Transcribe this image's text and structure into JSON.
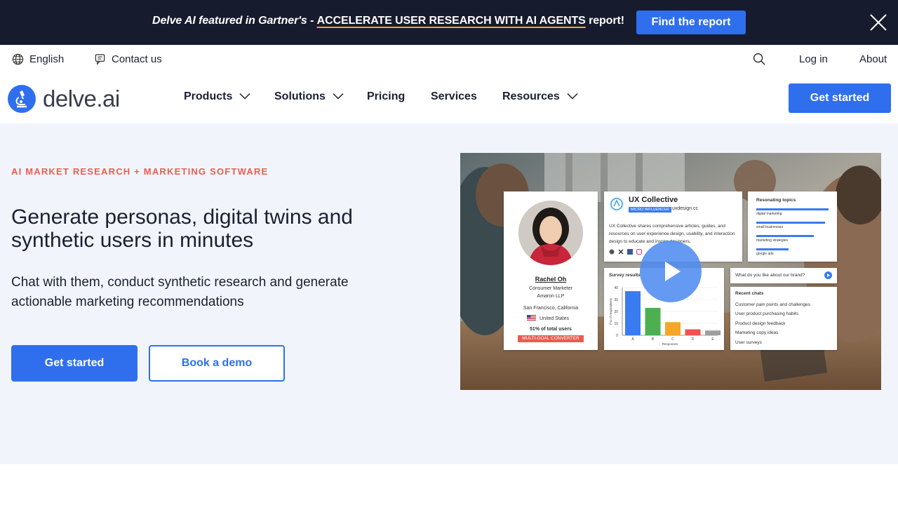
{
  "announcement": {
    "lead": "Delve AI featured in Gartner's - ",
    "link": "ACCELERATE USER RESEARCH WITH AI AGENTS",
    "tail": " report!",
    "button": "Find the report"
  },
  "utility": {
    "language": "English",
    "contact": "Contact us",
    "login": "Log in",
    "about": "About"
  },
  "nav": {
    "logo": "delve.ai",
    "items": [
      "Products",
      "Solutions",
      "Pricing",
      "Services",
      "Resources"
    ],
    "cta": "Get started"
  },
  "hero": {
    "eyebrow": "AI MARKET RESEARCH + MARKETING SOFTWARE",
    "headline": "Generate personas, digital twins and synthetic users in minutes",
    "subline": "Chat with them, conduct synthetic research and generate actionable marketing recommendations",
    "primary_button": "Get started",
    "secondary_button": "Book a demo"
  },
  "video": {
    "persona": {
      "name": "Rachel Oh",
      "role": "Consumer Marketer",
      "company": "Amaron LLP",
      "location": "San Francisco, California",
      "country": "United States",
      "share": "51% of total users",
      "tag": "MULTI-GOAL CONVERTER"
    },
    "brand": {
      "name": "UX Collective",
      "badge": "MICRO INFLUENCER",
      "domain": "uxdesign.cc",
      "desc": "UX Collective shares comprehensive articles, guides, and resources on user experience design, usability, and interaction design to educate and inspire designers."
    },
    "topics": {
      "title": "Resonating topics",
      "items": [
        "digital marketing",
        "small businesses",
        "marketing strategies",
        "google ads"
      ],
      "levels": [
        1.0,
        0.95,
        0.8,
        0.45
      ]
    },
    "survey": {
      "title": "Survey results",
      "ylabel": "(%) of respondents",
      "xlabel": "Responses",
      "ticks": [
        "40",
        "30",
        "20",
        "10",
        "0"
      ],
      "categories": [
        "A",
        "B",
        "C",
        "D",
        "E"
      ],
      "values": [
        37,
        23,
        11,
        5,
        4
      ],
      "colors": [
        "#3a7bef",
        "#4caf50",
        "#f5a623",
        "#ef5350",
        "#9e9e9e"
      ]
    },
    "chat": {
      "question": "What do you like about our brand?",
      "recent_title": "Recent chats",
      "recent": [
        "Customer pain points and challenges",
        "User product purchasing habits",
        "Product design feedback",
        "Marketing copy ideas",
        "User surveys"
      ]
    }
  },
  "colors": {
    "brand_blue": "#2f6fed",
    "announce_bg": "#161b2e",
    "eyebrow": "#ef5b50",
    "hero_bg": "#f1f5fb"
  },
  "icons": [
    "globe-icon",
    "chat-icon",
    "search-icon",
    "close-icon",
    "chevron-down-icon",
    "play-icon"
  ]
}
